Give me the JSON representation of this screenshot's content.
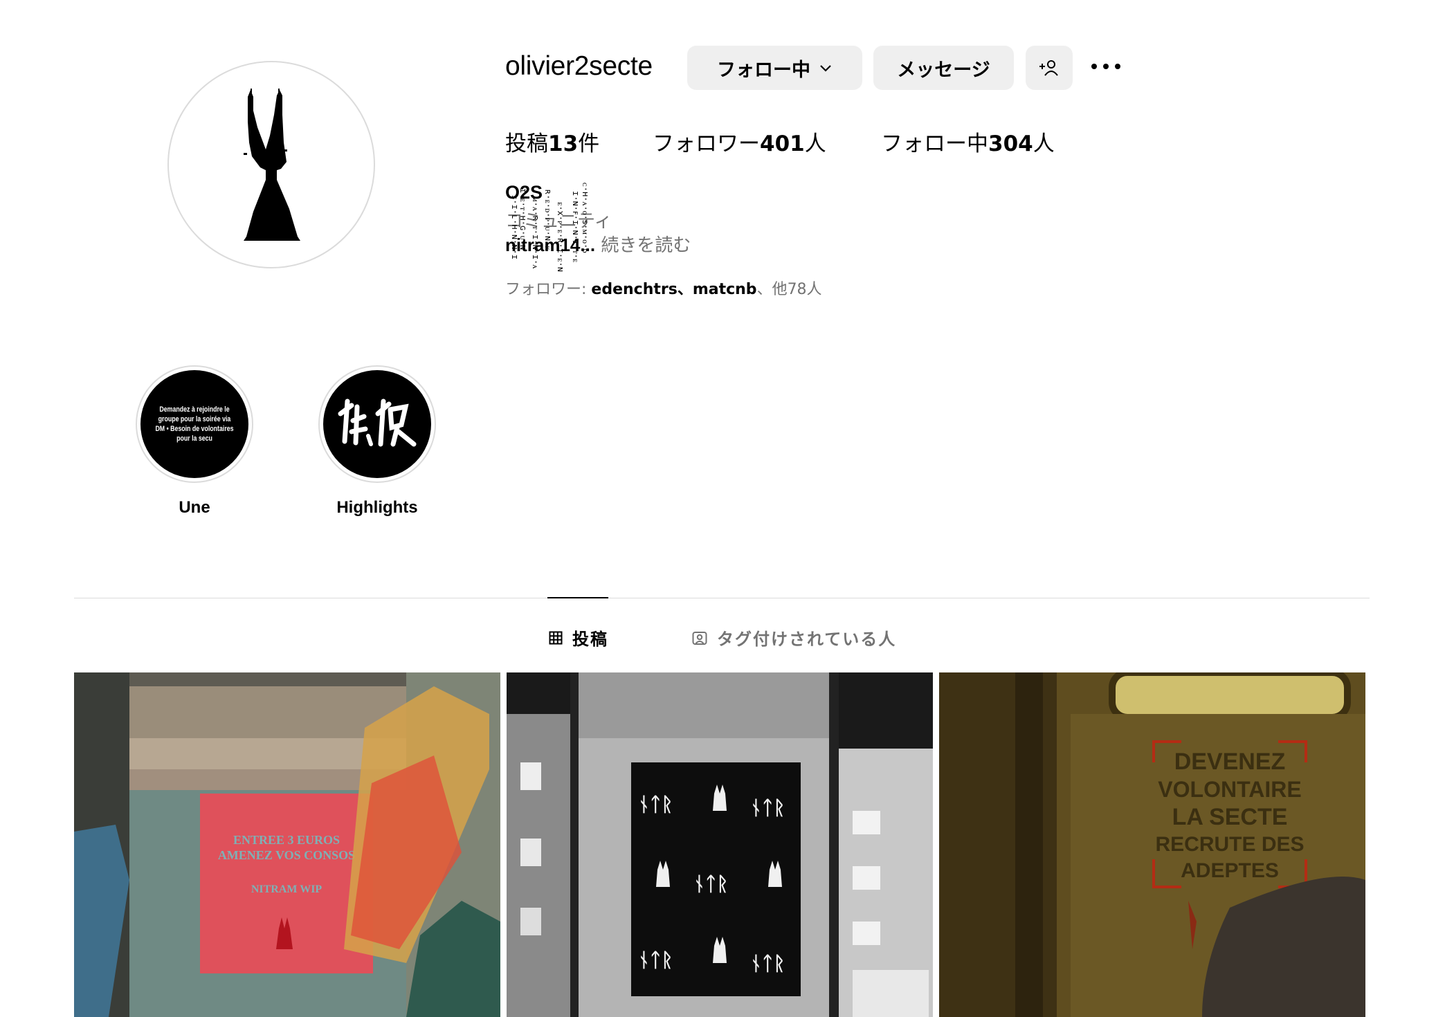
{
  "profile": {
    "username": "olivier2secte",
    "full_name": "O2S",
    "category": "コミュニティ",
    "bio_handle": "nitram14",
    "bio_ellipsis": "...",
    "bio_more": " 続きを読む",
    "followed_by_prefix": "フォロワー: ",
    "followed_by_names": "edenchtrs、matcnb",
    "followed_by_rest": "、他78人"
  },
  "actions": {
    "follow_label": "フォロー中",
    "message_label": "メッセージ"
  },
  "stats": {
    "posts_label": "投稿",
    "posts_count": "13",
    "posts_unit": "件",
    "followers_label": "フォロワー",
    "followers_count": "401",
    "followers_unit": "人",
    "following_label": "フォロー中",
    "following_count": "304",
    "following_unit": "人"
  },
  "highlights": [
    {
      "label": "Une",
      "cover_text": "Demandez à rejoindre le groupe pour la soirée via DM • Besoin de volontaires pour la secu"
    },
    {
      "label": "Highlights",
      "cover_text": ""
    }
  ],
  "tabs": [
    {
      "label": "投稿",
      "icon": "grid-icon",
      "active": true
    },
    {
      "label": "タグ付けされている人",
      "icon": "tag-person-icon",
      "active": false
    }
  ],
  "posts": [
    {
      "poster_lines": [
        "ENTREE 3 EUROS",
        "AMENEZ VOS CONSOS",
        "NITRAM WIP"
      ]
    },
    {
      "poster_lines": []
    },
    {
      "poster_lines": [
        "DEVENEZ",
        "VOLONTAIRE",
        "LA SECTE",
        "RECRUTE DES",
        "ADEPTES"
      ]
    }
  ],
  "colors": {
    "button_bg": "#efefef",
    "muted_text": "#737373",
    "divider": "#dbdbdb"
  }
}
